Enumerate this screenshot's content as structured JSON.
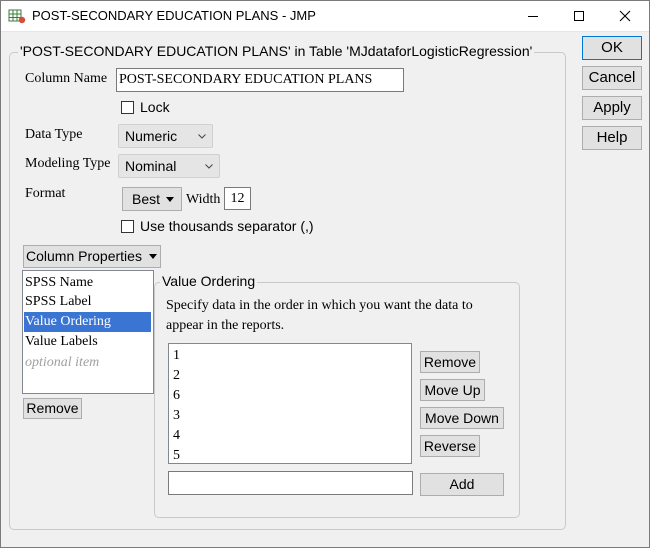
{
  "window": {
    "title": "POST-SECONDARY EDUCATION PLANS - JMP",
    "icon": "jmp-table-icon"
  },
  "main_group": {
    "legend": "'POST-SECONDARY EDUCATION PLANS' in Table 'MJdataforLogisticRegression'"
  },
  "fields": {
    "column_name_label": "Column Name",
    "column_name_value": "POST-SECONDARY EDUCATION PLANS",
    "lock_label": "Lock",
    "data_type_label": "Data Type",
    "data_type_value": "Numeric",
    "modeling_type_label": "Modeling Type",
    "modeling_type_value": "Nominal",
    "format_label": "Format",
    "format_value": "Best",
    "width_label": "Width",
    "width_value": "12",
    "thousands_label": "Use thousands separator (,)"
  },
  "column_properties": {
    "button_label": "Column Properties",
    "items": [
      {
        "label": "SPSS Name"
      },
      {
        "label": "SPSS Label"
      },
      {
        "label": "Value Ordering"
      },
      {
        "label": "Value Labels"
      },
      {
        "label": "optional item"
      }
    ],
    "selected": "Value Ordering",
    "remove_label": "Remove"
  },
  "value_ordering": {
    "legend": "Value Ordering",
    "instruction_line1": "Specify data in the order in which you want the data to",
    "instruction_line2": "appear in the reports.",
    "values": [
      "1",
      "2",
      "6",
      "3",
      "4",
      "5"
    ],
    "buttons": {
      "remove": "Remove",
      "move_up": "Move Up",
      "move_down": "Move Down",
      "reverse": "Reverse",
      "add": "Add"
    },
    "add_input_value": ""
  },
  "dialog_buttons": {
    "ok": "OK",
    "cancel": "Cancel",
    "apply": "Apply",
    "help": "Help"
  },
  "colors": {
    "selection": "#3b75d4",
    "focus_border": "#0078d7",
    "background": "#f0f0f0"
  }
}
